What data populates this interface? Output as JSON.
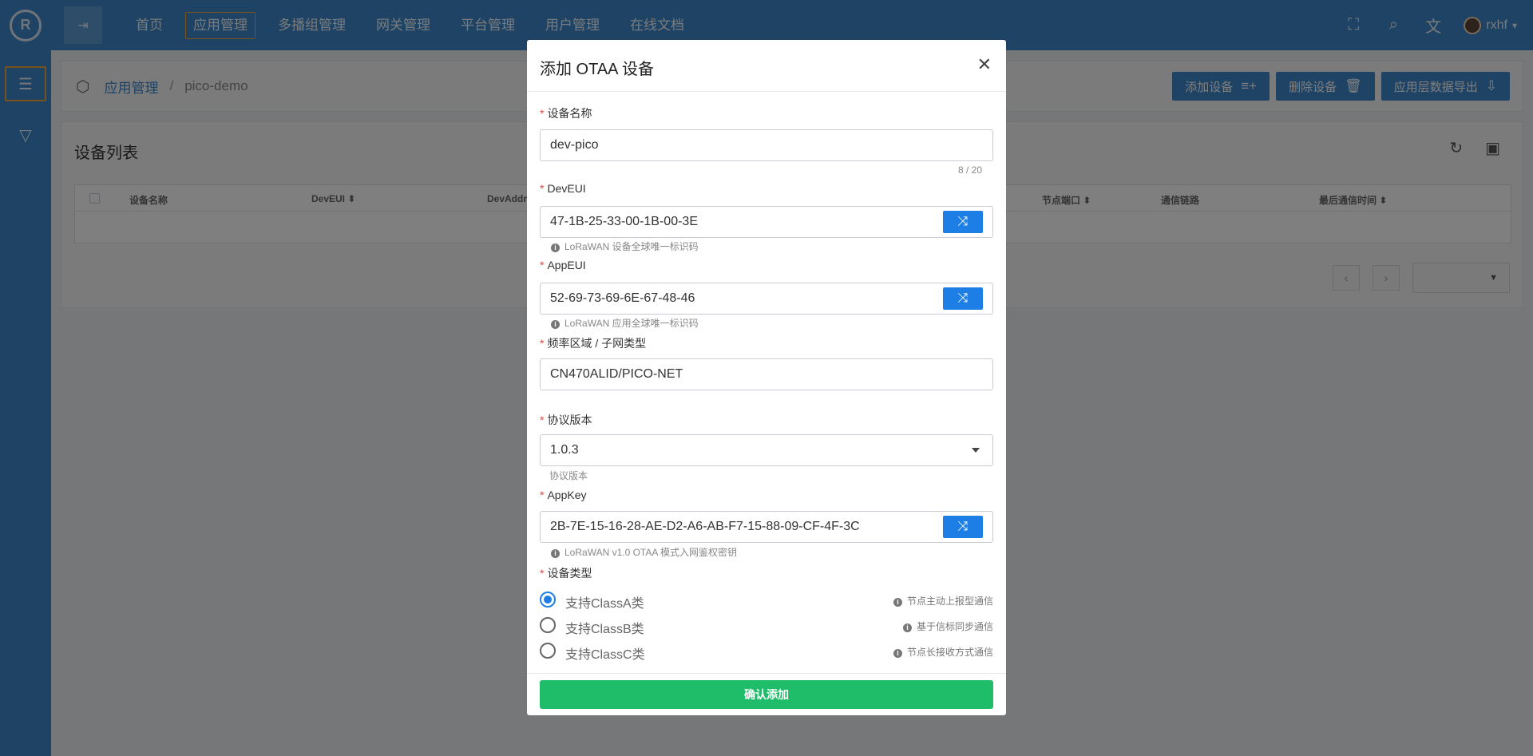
{
  "topbar": {
    "nav": [
      "首页",
      "应用管理",
      "多播组管理",
      "网关管理",
      "平台管理",
      "用户管理",
      "在线文档"
    ],
    "active_nav": "应用管理",
    "icons": [
      "fullscreen-icon",
      "search-icon",
      "translate-icon"
    ],
    "username": "rxhf"
  },
  "breadcrumb": {
    "parent": "应用管理",
    "separator": "/",
    "current": "pico-demo"
  },
  "actions": {
    "add_device": "添加设备",
    "delete_device": "删除设备",
    "export": "应用层数据导出"
  },
  "device_list": {
    "title": "设备列表",
    "columns": [
      "设备名称",
      "DevEUI",
      "DevAddr",
      "节点端口",
      "通信链路",
      "最后通信时间"
    ]
  },
  "modal": {
    "title": "添加 OTAA 设备",
    "required_mark": "*",
    "device_name": {
      "label": "设备名称",
      "value": "dev-pico",
      "counter": "8 / 20"
    },
    "deveui": {
      "label": "DevEUI",
      "value": "47-1B-25-33-00-1B-00-3E",
      "hint": "LoRaWAN 设备全球唯一标识码"
    },
    "appeui": {
      "label": "AppEUI",
      "value": "52-69-73-69-6E-67-48-46",
      "hint": "LoRaWAN 应用全球唯一标识码"
    },
    "region": {
      "label": "频率区域 / 子网类型",
      "value": "CN470ALID/PICO-NET"
    },
    "protocol": {
      "label": "协议版本",
      "value": "1.0.3",
      "hint": "协议版本"
    },
    "appkey": {
      "label": "AppKey",
      "value": "2B-7E-15-16-28-AE-D2-A6-AB-F7-15-88-09-CF-4F-3C",
      "hint": "LoRaWAN v1.0 OTAA 模式入网鉴权密钥"
    },
    "device_type": {
      "label": "设备类型",
      "options": [
        {
          "label": "支持ClassA类",
          "hint": "节点主动上报型通信",
          "selected": true
        },
        {
          "label": "支持ClassB类",
          "hint": "基于信标同步通信",
          "selected": false
        },
        {
          "label": "支持ClassC类",
          "hint": "节点长接收方式通信",
          "selected": false
        }
      ]
    },
    "confirm": "确认添加"
  },
  "colors": {
    "primary": "#3c87c8",
    "accent": "#f0a63a",
    "generate_button": "#1d7fe5",
    "confirm_button": "#1fbd6a",
    "required": "#e04a3a"
  }
}
